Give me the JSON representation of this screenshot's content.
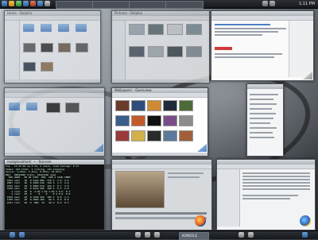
{
  "panel": {
    "clock": "1:11 PM",
    "taskbar_items": [
      "",
      "",
      "",
      ""
    ],
    "active_task": "KONSOLE"
  },
  "windows": {
    "dolphin_home": {
      "title": "Home - Dolphin"
    },
    "dolphin_pictures": {
      "title": "Pictures - Dolphin"
    },
    "firefox": {
      "title": ""
    },
    "dolphin_folders": {
      "title": ""
    },
    "gwenview": {
      "title": "Wallpapers - Gwenview"
    },
    "sidebar_app": {
      "title": ""
    },
    "konsole": {
      "title": "root@localhost: ~ - Konsole"
    },
    "video_editor": {
      "title": ""
    },
    "kontact": {
      "title": ""
    }
  },
  "terminal_lines": [
    "top - 13:11:02 up 2:14, 2 users, load average: 0.31",
    "Tasks: 142 total, 1 running, 141 sleeping",
    "Cpu(s): 4.0%us, 1.2%sy, 0.0%ni, 94.6%id",
    "Mem:  2065260k total, 1842116k used",
    "",
    "  PID USER   PR NI VIRT  RES  SHR S %CPU %MEM",
    " 3241 user   20  0 412m 88m  31m S  3.9  4.3",
    " 2987 root   20  0 189m 54m  12m S  1.3  2.6",
    " 3312 user   20  0 298m 61m  22m S  0.7  3.0",
    " 3120 user   20  0 221m 40m  18m S  0.3  2.0",
    "    1 root   20  0  2.9m 1.2m 1.0m S 0.0  0.1",
    "    2 root   20  0     0    0    0 S 0.0  0.0",
    " 1024 user   20  0 134m 22m  10m S  0.0  1.1",
    " 1190 user   20  0 109m 18m   9m S  0.0  0.9",
    " 2211 root   20  0  88m  7m   4m S  0.0  0.3"
  ],
  "colors": {
    "folder": "#4a7fbf",
    "panel": "#1f2328",
    "terminal_bg": "#111111"
  }
}
